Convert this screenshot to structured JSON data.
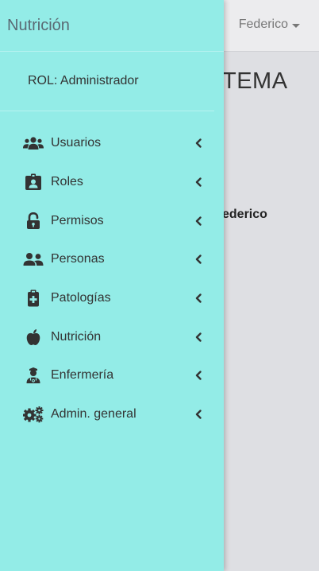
{
  "sidebar": {
    "brand": "Nutrición",
    "role_text": "ROL: Administrador",
    "items": [
      {
        "label": "Usuarios",
        "icon": "users-icon"
      },
      {
        "label": "Roles",
        "icon": "id-badge-icon"
      },
      {
        "label": "Permisos",
        "icon": "unlock-icon"
      },
      {
        "label": "Personas",
        "icon": "user-friends-icon"
      },
      {
        "label": "Patologías",
        "icon": "clipboard-medical-icon"
      },
      {
        "label": "Nutrición",
        "icon": "apple-icon"
      },
      {
        "label": "Enfermería",
        "icon": "user-nurse-icon"
      },
      {
        "label": "Admin. general",
        "icon": "cogs-icon"
      }
    ]
  },
  "topbar": {
    "user_name": "Federico"
  },
  "background": {
    "heading_partial": "TEMA",
    "name_partial": "ederico"
  },
  "colors": {
    "sidebar_bg": "#93ece7",
    "page_bg": "#dedfe3",
    "topbar_bg": "#ececee",
    "text": "#333333"
  }
}
